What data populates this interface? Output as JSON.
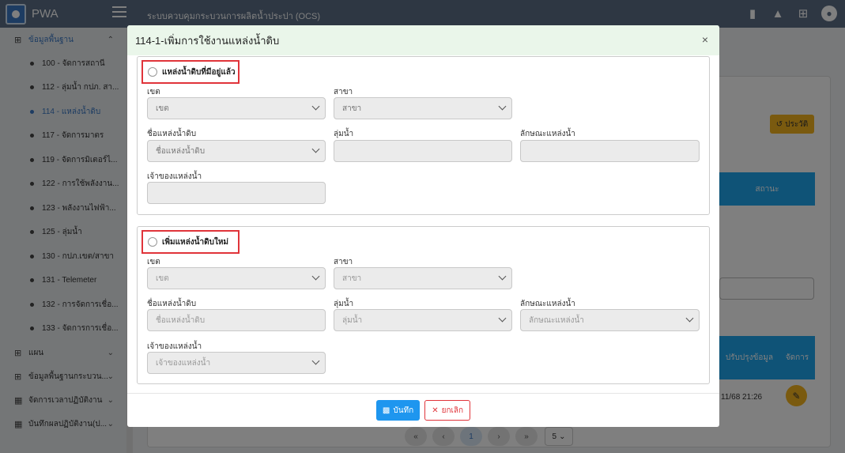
{
  "app": {
    "name": "PWA",
    "system_title": "ระบบควบคุมกระบวนการผลิตน้ำประปา (OCS)"
  },
  "sidebar": {
    "group_main": "ข้อมูลพื้นฐาน",
    "items": [
      "100 - จัดการสถานี",
      "112 - ลุ่มน้ำ กปภ. สา...",
      "114 - แหล่งน้ำดิบ",
      "117 - จัดการมาตร",
      "119 - จัดการมิเตอร์ไ...",
      "122 - การใช้พลังงาน...",
      "123 - พลังงานไฟฟ้า...",
      "125 - ลุ่มน้ำ",
      "130 - กปภ.เขต/สาขา",
      "131 - Telemeter",
      "132 - การจัดการเชื่อ...",
      "133 - จัดการการเชื่อ..."
    ],
    "groups": [
      "แผน",
      "ข้อมูลพื้นฐานกระบวน...",
      "จัดการเวลาปฏิบัติงาน",
      "บันทึกผลปฏิบัติงาน(ป..."
    ]
  },
  "background": {
    "history_label": "ประวัติ",
    "status_header": "สถานะ",
    "updated_header": "ปรับปรุงข้อมูล",
    "manage_header": "จัดการ",
    "row_date": "11/68 21:26",
    "pagination": {
      "first": "«",
      "prev": "‹",
      "current": "1",
      "next": "›",
      "last": "»",
      "page_size": "5"
    }
  },
  "modal": {
    "title": "114-1-เพิ่มการใช้งานแหล่งน้ำดิบ",
    "close": "×",
    "existing": {
      "radio_label": "แหล่งน้ำดิบที่มีอยู่แล้ว",
      "district_label": "เขต",
      "district_value": "เขต",
      "branch_label": "สาขา",
      "branch_value": "สาขา",
      "source_name_label": "ชื่อแหล่งน้ำดิบ",
      "source_name_value": "ชื่อแหล่งน้ำดิบ",
      "basin_label": "ลุ่มน้ำ",
      "type_label": "ลักษณะแหล่งน้ำ",
      "owner_label": "เจ้าของแหล่งน้ำ"
    },
    "new": {
      "radio_label": "เพิ่มแหล่งน้ำดิบใหม่",
      "district_label": "เขต",
      "district_value": "เขต",
      "branch_label": "สาขา",
      "branch_value": "สาขา",
      "source_name_label": "ชื่อแหล่งน้ำดิบ",
      "source_name_placeholder": "ชื่อแหล่งน้ำดิบ",
      "basin_label": "ลุ่มน้ำ",
      "basin_value": "ลุ่มน้ำ",
      "type_label": "ลักษณะแหล่งน้ำ",
      "type_value": "ลักษณะแหล่งน้ำ",
      "owner_label": "เจ้าของแหล่งน้ำ",
      "owner_value": "เจ้าของแหล่งน้ำ"
    },
    "save_label": "บันทึก",
    "cancel_label": "ยกเลิก"
  },
  "colors": {
    "topbar": "#5c6f86",
    "primary": "#1e96ef",
    "danger": "#e0343a",
    "warning": "#f5b41f",
    "modal_header": "#eaf6ea"
  }
}
